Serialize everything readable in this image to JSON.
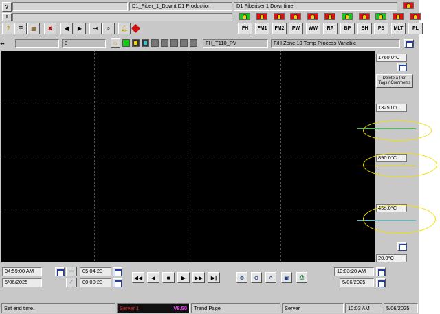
{
  "header": {
    "help_label": "?",
    "alarm_flag_label": "!",
    "production_text": "D1_Fiber_1_Downt D1 Production",
    "downtime_text": "D1 Fiberiser 1 Downtime"
  },
  "area_buttons": [
    {
      "label": "FH",
      "state": "green"
    },
    {
      "label": "FM1",
      "state": "red"
    },
    {
      "label": "FM2",
      "state": "red"
    },
    {
      "label": "PW",
      "state": "red"
    },
    {
      "label": "WW",
      "state": "red"
    },
    {
      "label": "RP",
      "state": "red"
    },
    {
      "label": "BP",
      "state": "green"
    },
    {
      "label": "BH",
      "state": "red"
    },
    {
      "label": "PS",
      "state": "green"
    },
    {
      "label": "MLT",
      "state": "red"
    },
    {
      "label": "PL",
      "state": "red"
    }
  ],
  "pen_bar": {
    "pen_count": "0",
    "tag_name": "FH_T110_PV",
    "tag_description": "F/H Zone 10 Temp Process Variable"
  },
  "scale": {
    "labels": [
      "1760.0°C",
      "1325.0°C",
      "890.0°C",
      "455.0°C",
      "20.0°C"
    ],
    "delete_pen_label": "Delete a Pen\nTags / Comments"
  },
  "time_controls": {
    "start_time": "04:59:00 AM",
    "start_date": "5/06/2025",
    "duration": "05:04:20",
    "interval": "00:00:20",
    "end_time": "10:03:20 AM",
    "end_date": "5/06/2025"
  },
  "status_bar": {
    "message": "Set end time.",
    "server_name": "Server 1",
    "version": "V8.50",
    "page_name": "Trend Page",
    "server_label": "Server",
    "clock_time": "10:03 AM",
    "clock_date": "5/06/2025"
  },
  "colors": {
    "plot_background": "#000000",
    "alarm_red": "#e01010",
    "alarm_green": "#18c818",
    "annotation_yellow": "#f0e000",
    "server_text": "#ff2020",
    "version_text": "#ff40ff"
  }
}
